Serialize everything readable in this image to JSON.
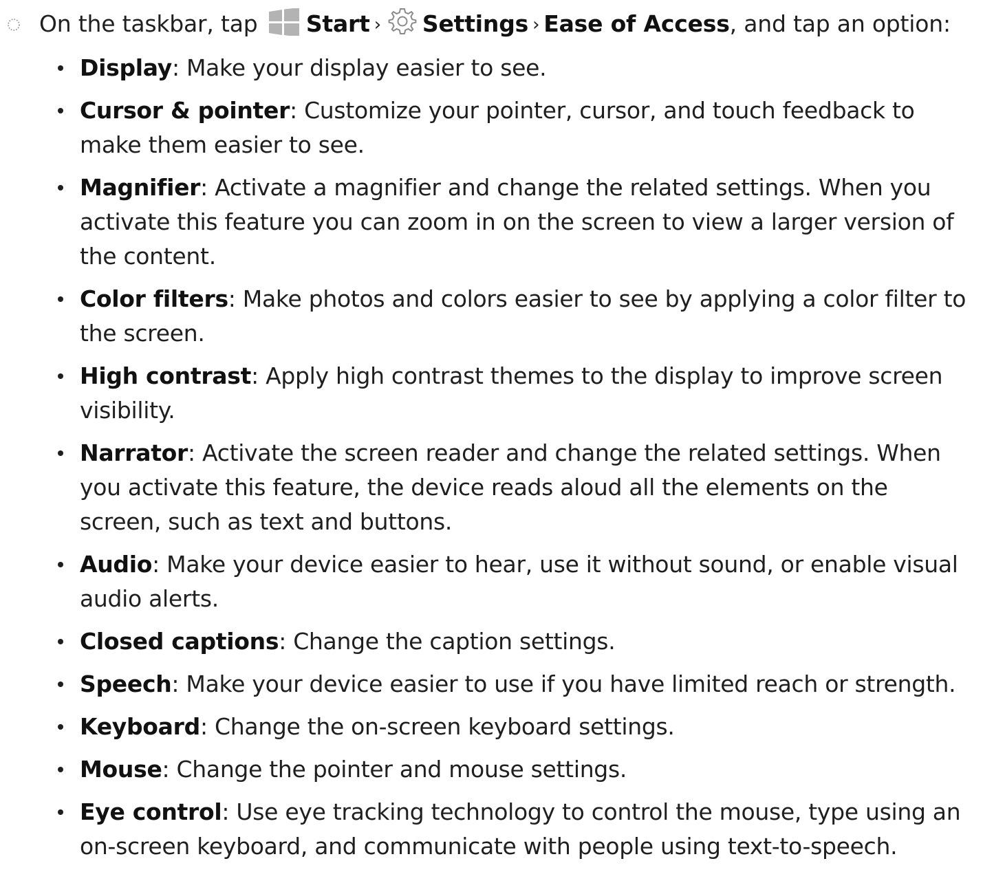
{
  "step": {
    "intro": "On the taskbar, tap",
    "start_label": "Start",
    "separator_1": "›",
    "settings_label": "Settings",
    "separator_2": "›",
    "ease_label": "Ease of Access",
    "outro": ", and tap an option:",
    "icons": {
      "marker": "dotted-circle-icon",
      "start": "windows-start-icon",
      "settings": "gear-icon"
    },
    "colors": {
      "start_icon": "#b3b3b3",
      "gear_icon": "#8a8a8a",
      "text": "#1f1f1f"
    }
  },
  "options": [
    {
      "term": "Display",
      "desc": ": Make your display easier to see."
    },
    {
      "term": "Cursor & pointer",
      "desc": ": Customize your pointer, cursor, and touch feedback to make them easier to see."
    },
    {
      "term": "Magnifier",
      "desc": ": Activate a magnifier and change the related settings. When you activate this feature you can zoom in on the screen to view a larger version of the content."
    },
    {
      "term": "Color filters",
      "desc": ": Make photos and colors easier to see by applying a color filter to the screen."
    },
    {
      "term": "High contrast",
      "desc": ": Apply high contrast themes to the display to improve screen visibility."
    },
    {
      "term": "Narrator",
      "desc": ": Activate the screen reader and change the related settings. When you activate this feature, the device reads aloud all the elements on the screen, such as text and buttons."
    },
    {
      "term": "Audio",
      "desc": ": Make your device easier to hear, use it without sound, or enable visual audio alerts."
    },
    {
      "term": "Closed captions",
      "desc": ": Change the caption settings."
    },
    {
      "term": "Speech",
      "desc": ": Make your device easier to use if you have limited reach or strength."
    },
    {
      "term": "Keyboard",
      "desc": ": Change the on-screen keyboard settings."
    },
    {
      "term": "Mouse",
      "desc": ": Change the pointer and mouse settings."
    },
    {
      "term": "Eye control",
      "desc": ": Use eye tracking technology to control the mouse, type using an on-screen keyboard, and communicate with people using text-to-speech."
    }
  ]
}
